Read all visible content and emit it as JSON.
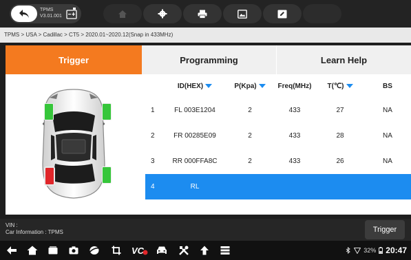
{
  "app": {
    "title": "TPMS",
    "version": "V3.01.001"
  },
  "breadcrumb": "TPMS > USA > Cadillac > CT5 > 2020.01~2020.12(Snap in 433MHz)",
  "tabs": {
    "trigger": "Trigger",
    "programming": "Programming",
    "learn_help": "Learn Help"
  },
  "table": {
    "headers": [
      "",
      "ID(HEX)",
      "P(Kpa)",
      "Freq(MHz)",
      "T(℃)",
      "BS"
    ],
    "rows": [
      {
        "num": "1",
        "id": "FL  003E1204",
        "p": "2",
        "freq": "433",
        "t": "27",
        "bs": "NA"
      },
      {
        "num": "2",
        "id": "FR  00285E09",
        "p": "2",
        "freq": "433",
        "t": "28",
        "bs": "NA"
      },
      {
        "num": "3",
        "id": "RR  000FFA8C",
        "p": "2",
        "freq": "433",
        "t": "26",
        "bs": "NA"
      },
      {
        "num": "4",
        "id": "RL",
        "p": "",
        "freq": "",
        "t": "",
        "bs": ""
      }
    ]
  },
  "tire_status": {
    "front_left": "green",
    "front_right": "green",
    "rear_left": "red",
    "rear_right": "green"
  },
  "info": {
    "vin": "VIN :",
    "car_info": "Car Information : TPMS"
  },
  "trigger_button": "Trigger",
  "status": {
    "battery": "32%",
    "time": "20:47"
  },
  "colors": {
    "accent": "#f47a1f",
    "selected": "#1c8cf0",
    "ok": "#36c63a",
    "bad": "#e0262a"
  }
}
